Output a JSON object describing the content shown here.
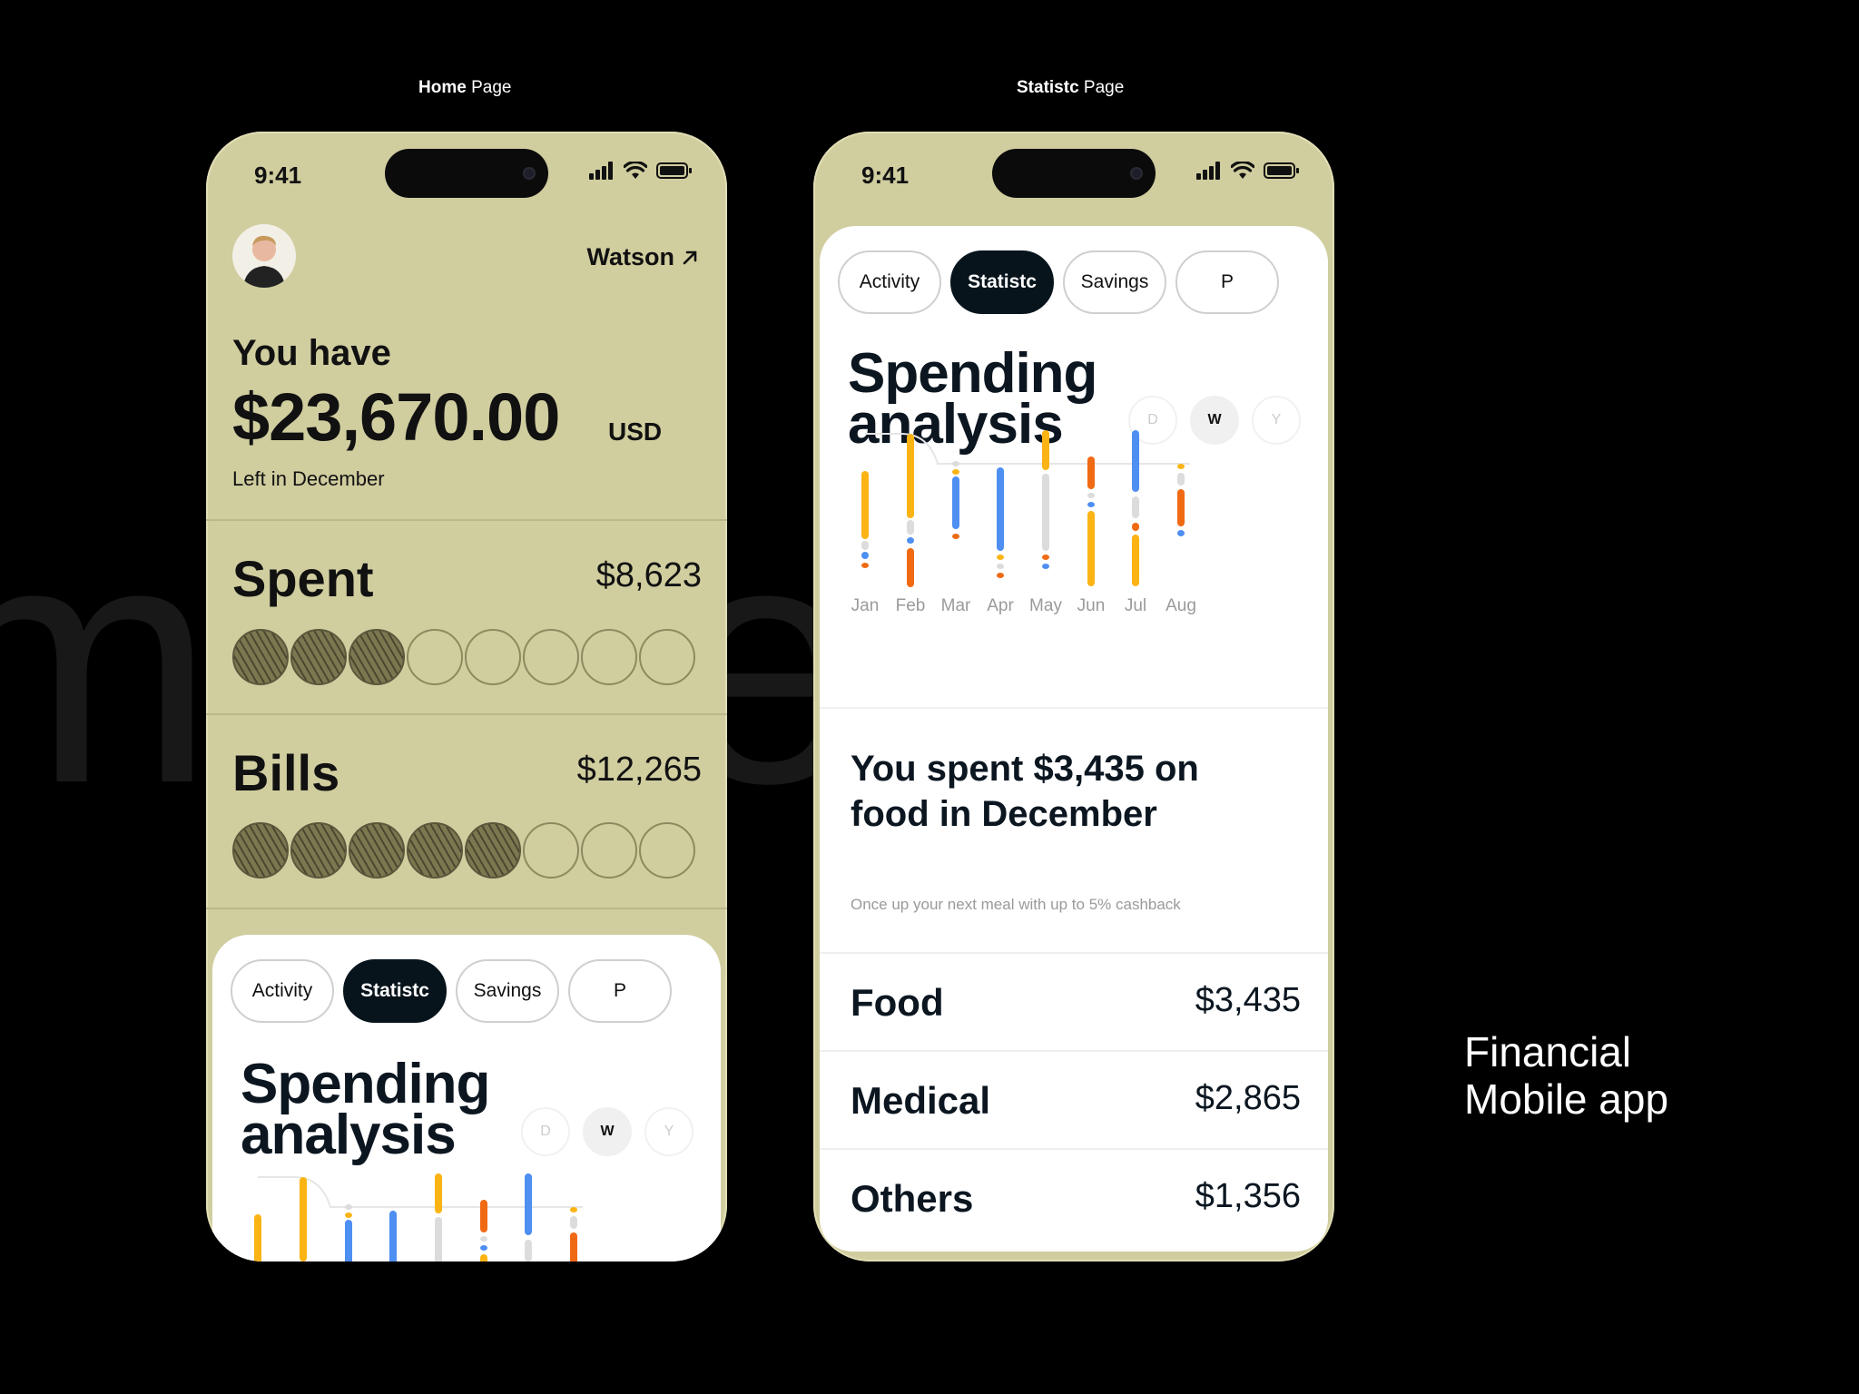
{
  "background_word": "mobile",
  "captions": {
    "home": {
      "bold": "Home",
      "rest": " Page"
    },
    "stats": {
      "bold": "Statistc",
      "rest": " Page"
    }
  },
  "tagline": {
    "line1": "Financial",
    "line2": "Mobile app"
  },
  "status_bar": {
    "time": "9:41"
  },
  "home": {
    "user_name": "Watson",
    "you_have": "You have",
    "amount": "$23,670.00",
    "currency": "USD",
    "left_in": "Left in December",
    "spent": {
      "label": "Spent",
      "value": "$8,623",
      "filled": 3,
      "total": 8
    },
    "bills": {
      "label": "Bills",
      "value": "$12,265",
      "filled": 5,
      "total": 8
    }
  },
  "tabs": [
    "Activity",
    "Statistc",
    "Savings",
    "P"
  ],
  "active_tab": "Statistc",
  "spending": {
    "title_line1": "Spending",
    "title_line2": "analysis",
    "periods": [
      "D",
      "W",
      "Y"
    ],
    "selected_period": "W"
  },
  "months": [
    "Jan",
    "Feb",
    "Mar",
    "Apr",
    "May",
    "Jun",
    "Jul",
    "Aug"
  ],
  "message": {
    "title": "You spent $3,435 on food in December",
    "subtitle": "Once up your next meal with up to 5% cashback"
  },
  "categories": [
    {
      "name": "Food",
      "value": "$3,435"
    },
    {
      "name": "Medical",
      "value": "$2,865"
    },
    {
      "name": "Others",
      "value": "$1,356"
    }
  ],
  "colors": {
    "yellow": "#fbb414",
    "orange": "#f06a14",
    "blue": "#4e8ff2",
    "gray": "#dcdcdc",
    "khaki": "#d0cd9f"
  }
}
